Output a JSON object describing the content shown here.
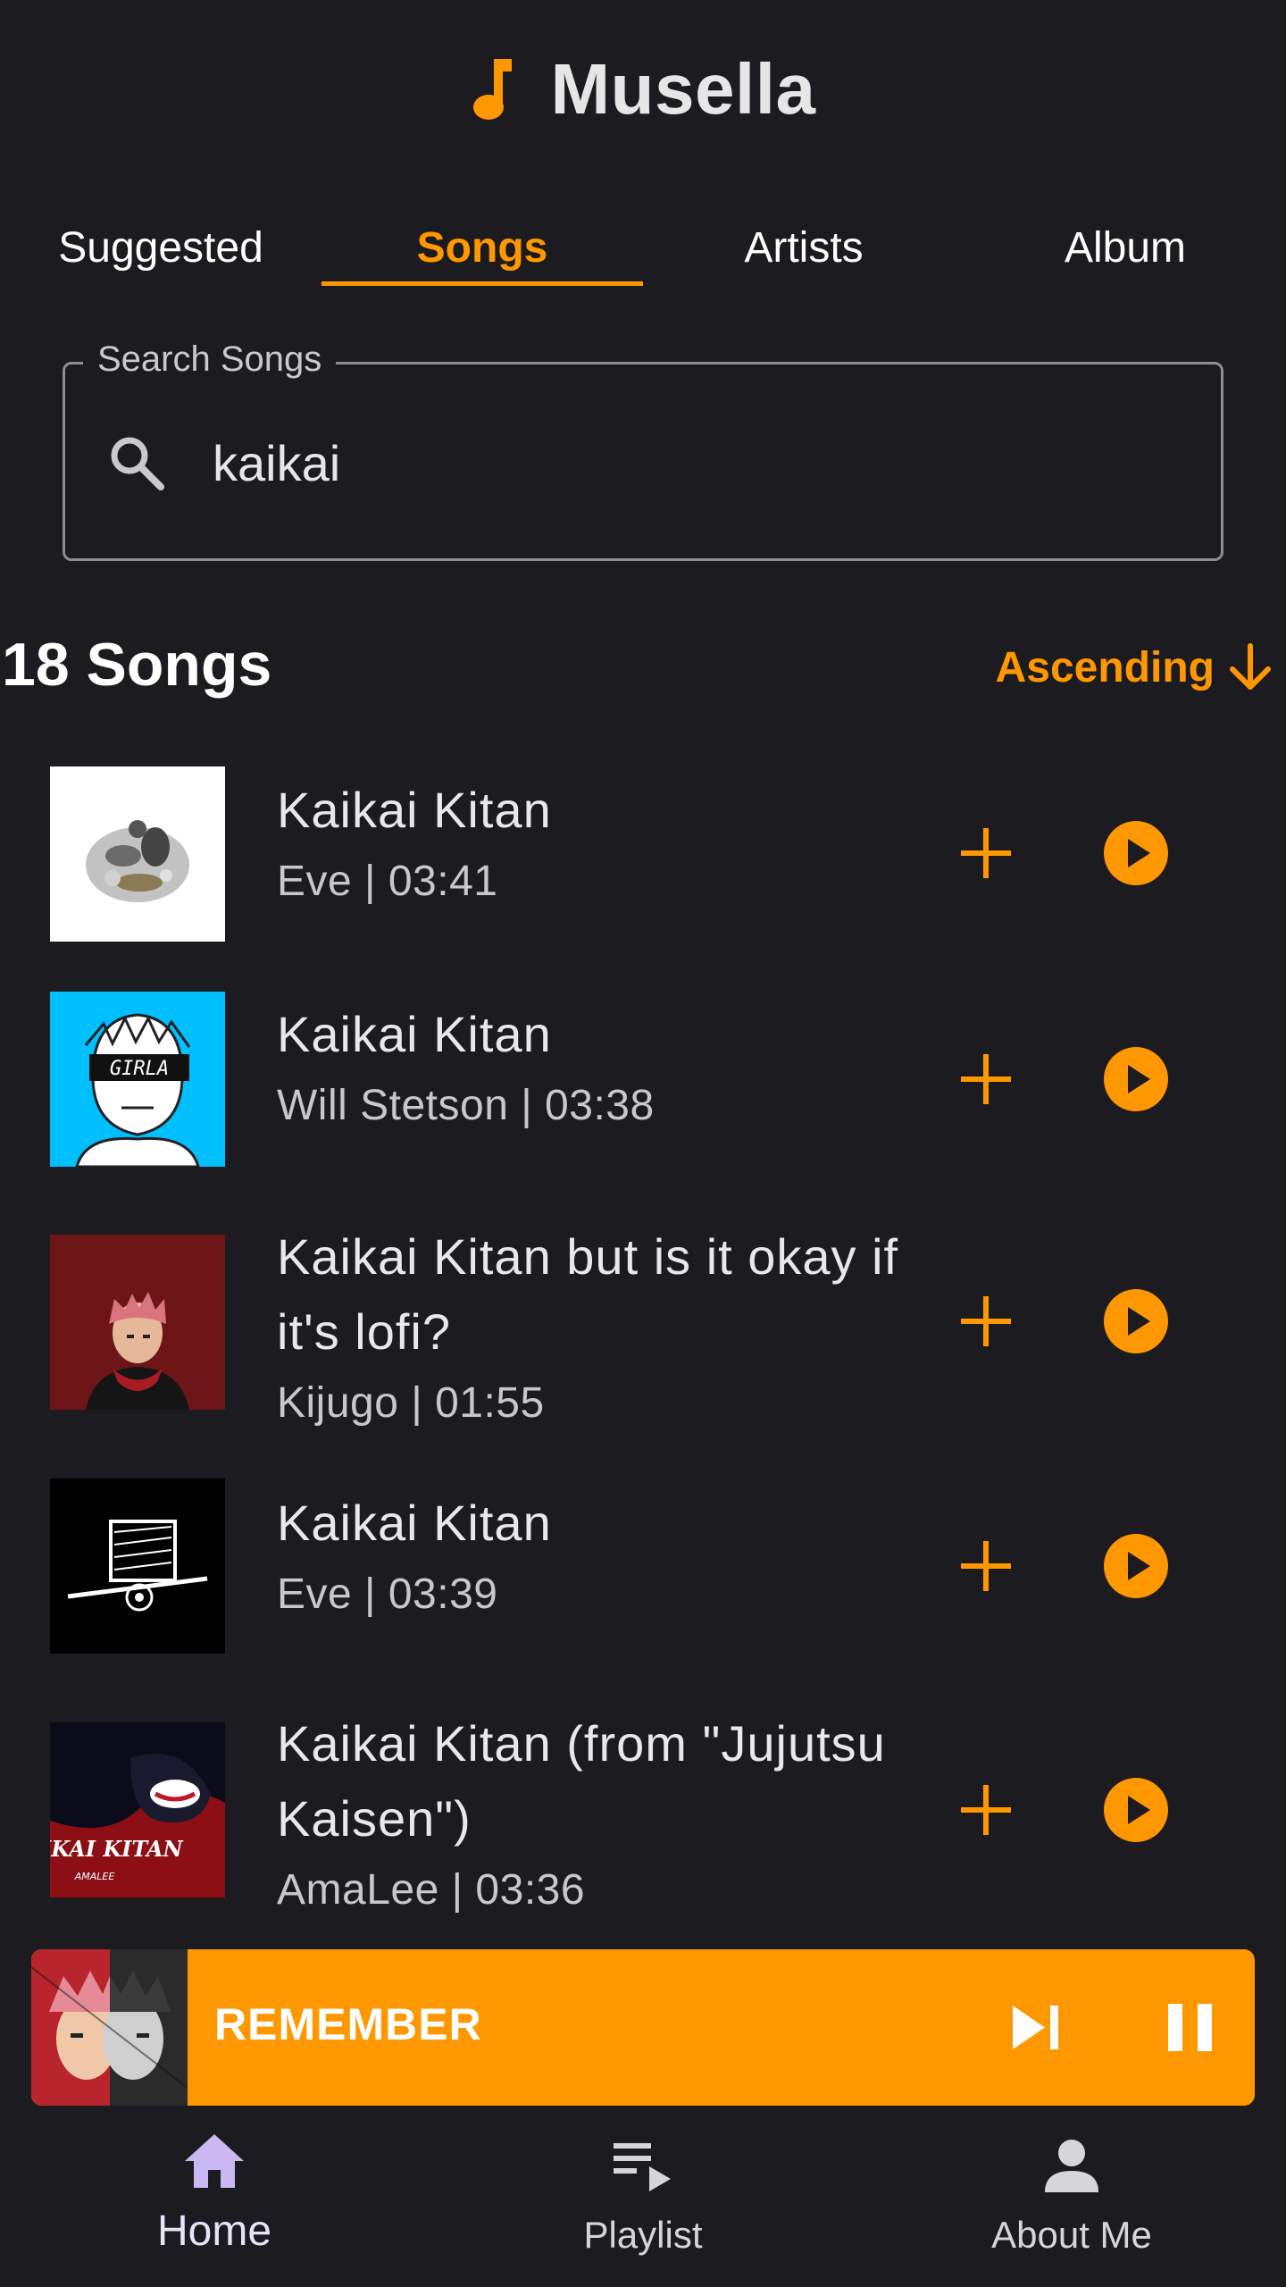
{
  "app": {
    "title": "Musella",
    "accent_color": "#ff9800",
    "background_color": "#1c1b20",
    "logo_icon": "music-note-icon"
  },
  "tabs": [
    {
      "label": "Suggested",
      "active": false
    },
    {
      "label": "Songs",
      "active": true
    },
    {
      "label": "Artists",
      "active": false
    },
    {
      "label": "Album",
      "active": false
    }
  ],
  "search": {
    "label": "Search Songs",
    "value": "kaikai",
    "icon": "search-icon"
  },
  "list_header": {
    "count_label": "18 Songs",
    "sort_label": "Ascending",
    "sort_icon": "arrow-down-icon"
  },
  "songs": [
    {
      "title": "Kaikai Kitan",
      "meta": "Eve | 03:41"
    },
    {
      "title": "Kaikai Kitan",
      "meta": "Will Stetson | 03:38"
    },
    {
      "title": "Kaikai Kitan but is it okay if it's lofi?",
      "meta": "Kijugo | 01:55"
    },
    {
      "title": "Kaikai Kitan",
      "meta": "Eve | 03:39"
    },
    {
      "title": "Kaikai Kitan (from \"Jujutsu Kaisen\")",
      "meta": "AmaLee | 03:36"
    }
  ],
  "cover_texts": {
    "cover2": "GIRLA",
    "cover5": "KAIKAI KITAN",
    "cover5_sub": "AMALEE"
  },
  "now_playing": {
    "title": "REMEMBER",
    "skip_icon": "skip-next-icon",
    "pause_icon": "pause-icon"
  },
  "bottom_nav": [
    {
      "label": "Home",
      "icon": "home-icon",
      "active": true
    },
    {
      "label": "Playlist",
      "icon": "playlist-play-icon",
      "active": false
    },
    {
      "label": "About Me",
      "icon": "person-icon",
      "active": false
    }
  ]
}
